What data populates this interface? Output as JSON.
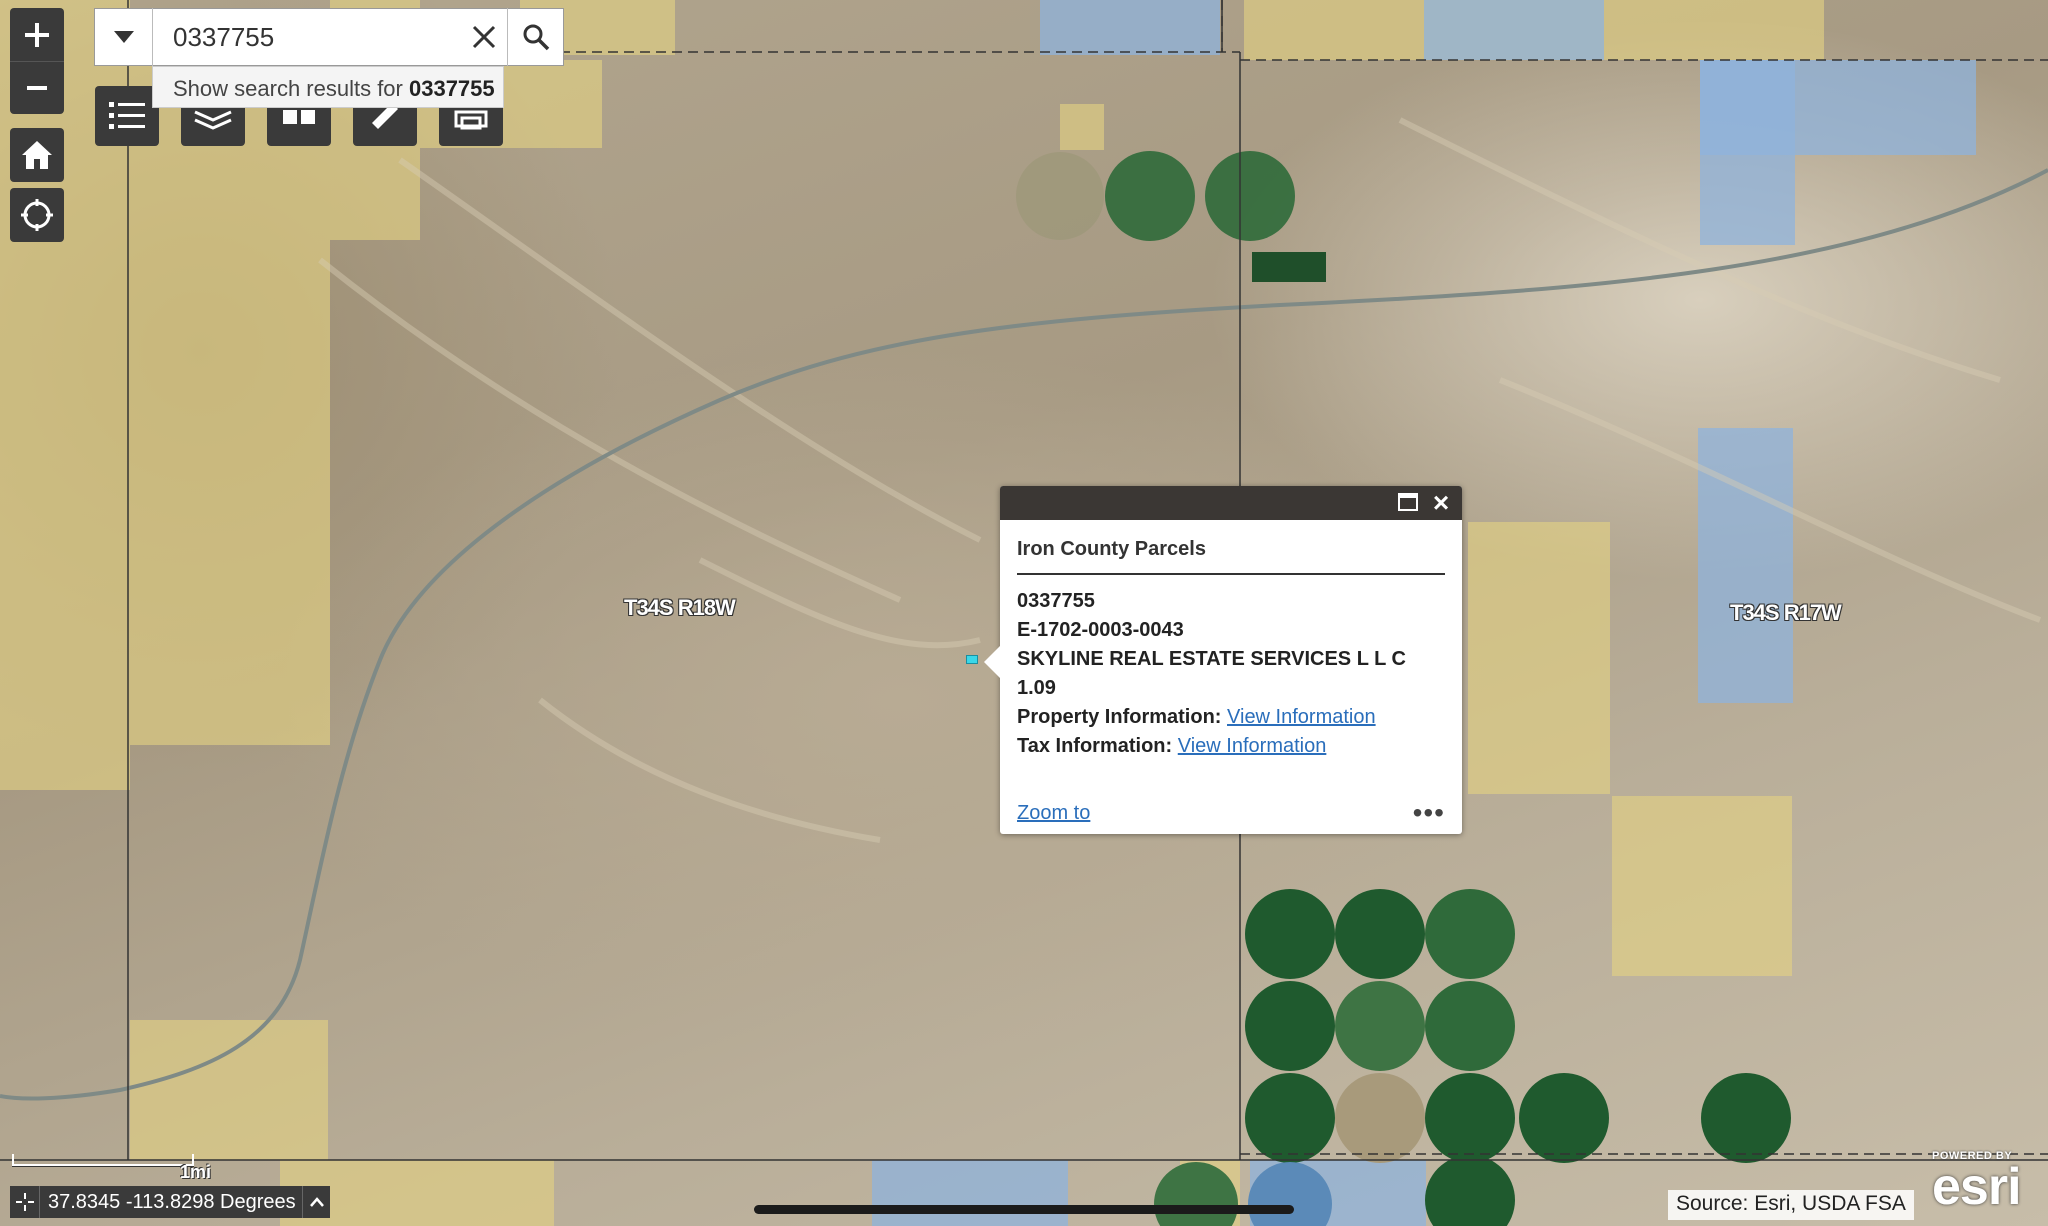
{
  "search": {
    "value": "0337755",
    "suggestion_prefix": "Show search results for ",
    "suggestion_term": "0337755"
  },
  "map_labels": {
    "township_west": "T34S R18W",
    "township_east": "T34S R17W"
  },
  "popup": {
    "title": "Iron County Parcels",
    "parcel_id": "0337755",
    "account": "E-1702-0003-0043",
    "owner": "SKYLINE REAL ESTATE SERVICES L L C",
    "acreage": "1.09",
    "property_label": "Property Information:",
    "property_link": "View Information",
    "tax_label": "Tax Information:",
    "tax_link": "View Information",
    "zoom_to": "Zoom to",
    "more": "•••"
  },
  "scale": {
    "label": "1mi"
  },
  "coordinates": {
    "text": "37.8345 -113.8298 Degrees"
  },
  "attribution": {
    "text": "Source: Esri, USDA FSA"
  },
  "esri_logo": {
    "powered_by": "POWERED BY",
    "brand": "esri"
  },
  "colors": {
    "control_bg": "#3a3a3a",
    "parcel_yellow": "#e4d283",
    "parcel_blue": "#8fb3dc",
    "field_green": "#2f6a3a",
    "link": "#2a6ebb"
  },
  "icons": {
    "zoom_in": "plus-icon",
    "zoom_out": "minus-icon",
    "home": "home-icon",
    "locate": "locate-icon",
    "legend": "list-icon",
    "layers": "layers-icon",
    "basemap": "basemap-icon",
    "measure": "ruler-icon",
    "print": "print-icon",
    "search_dropdown": "chevron-down-icon",
    "clear": "close-icon",
    "search": "search-icon",
    "maximize": "maximize-icon",
    "close": "close-icon"
  }
}
